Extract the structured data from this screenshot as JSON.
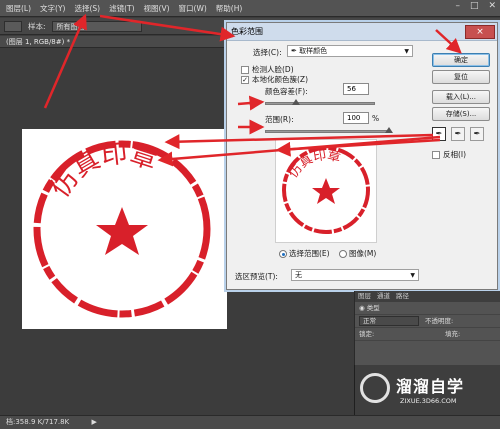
{
  "menubar": {
    "items": [
      "图层(L)",
      "文字(Y)",
      "选择(S)",
      "滤镜(T)",
      "视图(V)",
      "窗口(W)",
      "帮助(H)"
    ]
  },
  "optbar": {
    "sample_label": "样本:",
    "sample_value": "所有图层"
  },
  "doc_tab": "(图层 1, RGB/8#) *",
  "dialog": {
    "title": "色彩范围",
    "close": "×",
    "select_label": "选择(C):",
    "select_value": "取样颜色",
    "detect_faces": "检测人脸(D)",
    "localized_clusters": "本地化颜色簇(Z)",
    "fuzziness_label": "颜色容差(F):",
    "fuzziness_value": "56",
    "range_label": "范围(R):",
    "range_value": "100",
    "range_unit": "%",
    "radio_selection": "选择范围(E)",
    "radio_image": "图像(M)",
    "preview_label": "选区预览(T):",
    "preview_value": "无",
    "buttons": {
      "ok": "确定",
      "reset": "复位",
      "load": "载入(L)...",
      "save": "存储(S)..."
    },
    "invert": "反相(I)",
    "fuzziness_fraction": 0.28,
    "range_fraction": 1.0
  },
  "layers": {
    "tabs": [
      "图层",
      "通道",
      "路径"
    ],
    "kind": "类型",
    "blend": "正常",
    "opacity_label": "不透明度:",
    "lock_label": "锁定:",
    "fill_label": "填充:"
  },
  "stamp": {
    "text": "仿真印章"
  },
  "status": {
    "doc_size": "档:358.9 K/717.8K"
  },
  "watermark": {
    "title": "溜溜自学",
    "subtitle": "ZIXUE.3D66.COM"
  },
  "colors": {
    "stamp_red": "#d8202a",
    "arrow_red": "#e0262a",
    "ps_dark": "#3c3c3c"
  }
}
